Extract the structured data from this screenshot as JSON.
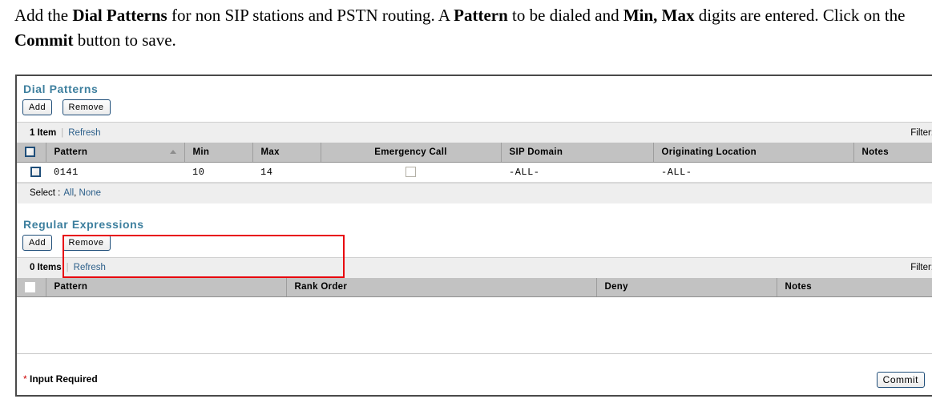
{
  "instructions": {
    "part1": "Add the ",
    "bold1": "Dial Patterns",
    "part2": " for non SIP stations and PSTN routing. A ",
    "bold2": "Pattern",
    "part3": " to be dialed and ",
    "bold3": "Min, Max",
    "part4": " digits are entered. Click on the ",
    "bold4": "Commit",
    "part5": " button to save."
  },
  "dial_patterns": {
    "title": "Dial Patterns",
    "add_label": "Add",
    "remove_label": "Remove",
    "count_label": "1 Item",
    "refresh_label": "Refresh",
    "filter_label": "Filter:",
    "columns": [
      "Pattern",
      "Min",
      "Max",
      "Emergency Call",
      "SIP Domain",
      "Originating Location",
      "Notes"
    ],
    "sort_column": "Pattern",
    "sort_direction": "ascending",
    "rows": [
      {
        "pattern": "0141",
        "min": "10",
        "max": "14",
        "emergency_call": false,
        "sip_domain": "-ALL-",
        "originating_location": "-ALL-",
        "notes": ""
      }
    ],
    "select_label": "Select :",
    "select_all_label": "All",
    "select_comma": ",",
    "select_none_label": "None"
  },
  "regular_expressions": {
    "title": "Regular Expressions",
    "add_label": "Add",
    "remove_label": "Remove",
    "count_label": "0 Items",
    "refresh_label": "Refresh",
    "filter_label": "Filter:",
    "columns": [
      "Pattern",
      "Rank Order",
      "Deny",
      "Notes"
    ],
    "rows": []
  },
  "footer": {
    "required_star": "*",
    "required_label": "Input Required",
    "commit_label": "Commit"
  },
  "colors": {
    "section_title": "#3d7f9e",
    "highlight": "#e8000d",
    "link": "#2c5f8a",
    "header_bg": "#c2c2c2",
    "toolbar_bg": "#eeeeee",
    "required_star": "#cc0000",
    "button_border": "#1f4e79"
  }
}
